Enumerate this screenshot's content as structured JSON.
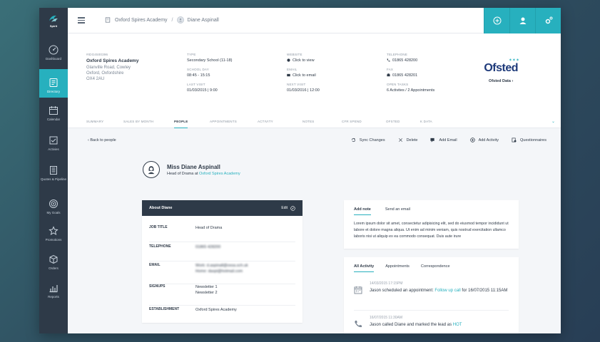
{
  "sidebar": {
    "logo": "Spirit",
    "items": [
      {
        "label": "Dashboard",
        "icon": "dashboard-icon"
      },
      {
        "label": "Directory",
        "icon": "directory-icon",
        "active": true
      },
      {
        "label": "Calendar",
        "icon": "calendar-icon"
      },
      {
        "label": "Activies",
        "icon": "activities-icon"
      },
      {
        "label": "Quotes & Pipeline",
        "icon": "quotes-icon"
      },
      {
        "label": "My Goals",
        "icon": "goals-icon"
      },
      {
        "label": "Promotions",
        "icon": "promotions-icon"
      },
      {
        "label": "Orders",
        "icon": "orders-icon"
      },
      {
        "label": "Reports",
        "icon": "reports-icon"
      }
    ]
  },
  "topbar": {
    "breadcrumb_school": "Oxford Spires Academy",
    "breadcrumb_sep": "/",
    "breadcrumb_person": "Diane Aspinall"
  },
  "school": {
    "id": "#IDG4500396",
    "name": "Oxford Spires Academy",
    "address1": "Glanville Road, Cowley",
    "address2": "Oxford, Oxfordshire",
    "postcode": "OX4 2AU",
    "type_label": "TYPE",
    "type": "Secondary School (11-18)",
    "schoolday_label": "SCHOOL DAY",
    "schoolday": "08:45 - 15:15",
    "lastvisit_label": "LAST VISIT",
    "lastvisit": "01/03/2015 | 9:00",
    "website_label": "WEBSITE",
    "website": "Click to view",
    "email_label": "EMAIL",
    "email": "Click to email",
    "nextvisit_label": "NEXT VISIT",
    "nextvisit": "01/03/2016 | 12:00",
    "telephone_label": "TELEPHONE",
    "telephone": "01865 428200",
    "fax_label": "FAX",
    "fax": "01865 428201",
    "opentasks_label": "OPEN TASKS",
    "opentasks": "6 Activites / 2 Appointments",
    "ofsted_brand": "Ofsted",
    "ofsted_link": "Ofsted Data ›"
  },
  "tabs": [
    "SUMMARY",
    "SALES BY MONTH",
    "PEOPLE",
    "APPOINTMENTS",
    "ACTIVITY",
    "NOTES",
    "CFR SPEND",
    "OFSTED",
    "K DATA"
  ],
  "actions": {
    "back": "‹  Back to people",
    "sync": "Sync Changes",
    "delete": "Delete",
    "add_email": "Add Email",
    "add_activity": "Add Activity",
    "questionnaires": "Questionnaires"
  },
  "person": {
    "name": "Miss Diane Aspinall",
    "role": "Head of Drama at",
    "school_link": "Oxford Spires Academy"
  },
  "about": {
    "title": "About Diane",
    "edit": "Edit",
    "job_title_label": "JOB TITLE",
    "job_title": "Head of Drama",
    "telephone_label": "TELEPHONE",
    "telephone": "01865 428200",
    "email_label": "EMAIL",
    "email_work": "Work: d.aspinall@oxsa.sch.uk",
    "email_home": "Home: daspi@hotmail.com",
    "signups_label": "SIGNUPS",
    "signup1": "Newsletter 1",
    "signup2": "Newsletter 2",
    "establishment_label": "ESTABLISHMENT",
    "establishment": "Oxford Spires Academy"
  },
  "note": {
    "tab_add": "Add note",
    "tab_email": "Send an email",
    "text": "Lorem ipsum dolor sit amet, consectetur adipisicing elit, sed do eiusmod tempor incididunt ut labore et dolore magna aliqua. Ut enim ad minim veniam, quis nostrud exercitation ullamco laboris nisi ut aliquip ex ea commodo consequat. Duis aute irure"
  },
  "activity": {
    "tabs": [
      "All Activity",
      "Appointments",
      "Correspondence"
    ],
    "entries": [
      {
        "time": "14/03/2015  17:15PM",
        "pre": "Jason scheduled an appointment: ",
        "highlight": "Follow up call",
        "post": " for 16/07/2015 11:15AM"
      },
      {
        "time": "16/07/2015  11:30AM",
        "pre": "Jason called Diane and marked the lead as ",
        "highlight": "HOT",
        "post": ""
      }
    ]
  },
  "colors": {
    "accent": "#27b0be",
    "sidebar": "#2e3a48"
  }
}
